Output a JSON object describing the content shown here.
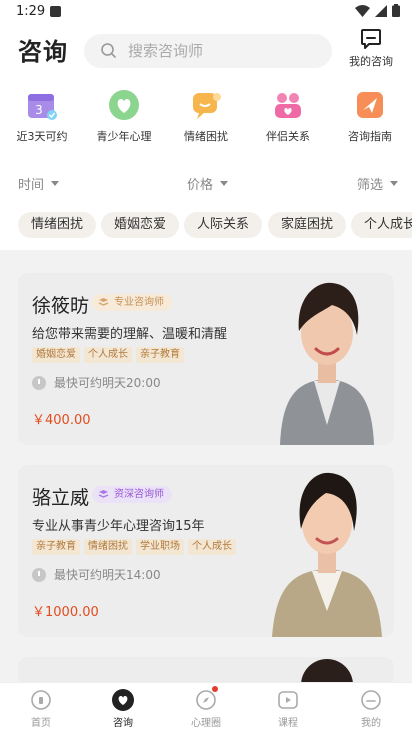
{
  "status_bar": {
    "time": "1:29"
  },
  "header": {
    "title": "咨询",
    "search_placeholder": "搜索咨询师",
    "my_consult_label": "我的咨询"
  },
  "shortcuts": [
    {
      "label": "近3天可约",
      "icon": "calendar-icon"
    },
    {
      "label": "青少年心理",
      "icon": "heart-leaf-icon"
    },
    {
      "label": "情绪困扰",
      "icon": "emotion-icon"
    },
    {
      "label": "伴侣关系",
      "icon": "couple-icon"
    },
    {
      "label": "咨询指南",
      "icon": "guide-icon"
    }
  ],
  "filters": {
    "time": "时间",
    "price": "价格",
    "screen": "筛选"
  },
  "topic_tags": [
    "情绪困扰",
    "婚姻恋爱",
    "人际关系",
    "家庭困扰",
    "个人成长"
  ],
  "counselors": [
    {
      "name": "徐筱昉",
      "badge": "专业咨询师",
      "description": "给您带来需要的理解、温暖和清醒",
      "tags": [
        "婚姻恋爱",
        "个人成长",
        "亲子教育"
      ],
      "availability": "最快可约明天20:00",
      "price": "￥400.00"
    },
    {
      "name": "骆立威",
      "badge": "资深咨询师",
      "description": "专业从事青少年心理咨询15年",
      "tags": [
        "亲子教育",
        "情绪困扰",
        "学业职场",
        "个人成长"
      ],
      "availability": "最快可约明天14:00",
      "price": "￥1000.00"
    }
  ],
  "bottom_nav": [
    {
      "label": "首页",
      "icon": "home-icon"
    },
    {
      "label": "咨询",
      "icon": "consult-heart-icon"
    },
    {
      "label": "心理圈",
      "icon": "compass-icon"
    },
    {
      "label": "课程",
      "icon": "play-icon"
    },
    {
      "label": "我的",
      "icon": "profile-icon"
    }
  ],
  "colors": {
    "accent_red": "#e24c1f",
    "badge_gold": "#c49054",
    "badge_purple": "#9556d6"
  }
}
